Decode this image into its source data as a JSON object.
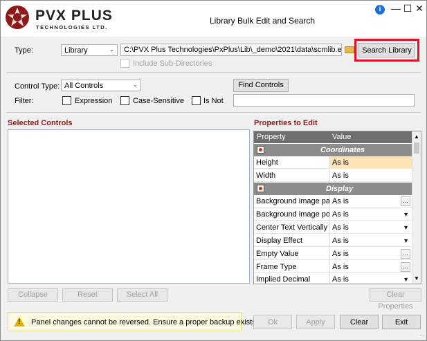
{
  "window": {
    "title": "Library Bulk Edit and Search",
    "logo_main": "PVX PLUS",
    "logo_sub": "TECHNOLOGIES LTD.",
    "help_glyph": "i",
    "minimize_glyph": "—",
    "maximize_glyph": "☐",
    "close_glyph": "✕"
  },
  "source": {
    "type_label": "Type:",
    "type_value": "Library",
    "path_value": "C:\\PVX Plus Technologies\\PxPlus\\Lib\\_demo\\2021\\data\\scmlib.en",
    "search_button": "Search Library",
    "include_subdirs_label": "Include Sub-Directories"
  },
  "filter": {
    "control_type_label": "Control Type:",
    "control_type_value": "All Controls",
    "find_button": "Find Controls",
    "filter_label": "Filter:",
    "expression_label": "Expression",
    "case_sensitive_label": "Case-Sensitive",
    "is_not_label": "Is Not",
    "filter_value": ""
  },
  "selected_controls": {
    "title": "Selected Controls",
    "items": [],
    "collapse_button": "Collapse",
    "reset_button": "Reset",
    "select_all_button": "Select All"
  },
  "properties": {
    "title": "Properties to Edit",
    "col_property": "Property",
    "col_value": "Value",
    "categories": [
      {
        "name": "Coordinates",
        "rows": [
          {
            "name": "Height",
            "value": "As is",
            "editor": "none"
          },
          {
            "name": "Width",
            "value": "As is",
            "editor": "none"
          }
        ]
      },
      {
        "name": "Display",
        "rows": [
          {
            "name": "Background image path",
            "value": "As is",
            "editor": "ellipsis"
          },
          {
            "name": "Background image position",
            "value": "As is",
            "editor": "dropdown"
          },
          {
            "name": "Center Text Vertically",
            "value": "As is",
            "editor": "dropdown"
          },
          {
            "name": "Display Effect",
            "value": "As is",
            "editor": "dropdown"
          },
          {
            "name": "Empty Value",
            "value": "As is",
            "editor": "ellipsis"
          },
          {
            "name": "Frame Type",
            "value": "As is",
            "editor": "ellipsis"
          },
          {
            "name": "Implied Decimal",
            "value": "As is",
            "editor": "dropdown"
          }
        ]
      }
    ],
    "clear_button": "Clear Properties"
  },
  "footer": {
    "warning": "Panel changes cannot be reversed.  Ensure a proper backup exists.",
    "ok_button": "Ok",
    "apply_button": "Apply",
    "clear_button": "Clear",
    "exit_button": "Exit"
  },
  "colors": {
    "section_title": "#8b1a1a",
    "highlight_box": "#e0141e",
    "selected_value": "#fce4b7",
    "grid_header": "#6f6f6f",
    "category_row": "#8c8c8c"
  }
}
